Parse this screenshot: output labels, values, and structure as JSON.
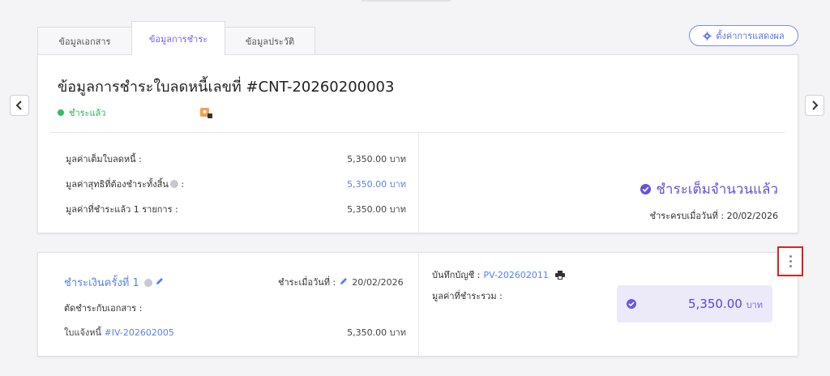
{
  "tabs": [
    {
      "label": "ข้อมูลเอกสาร"
    },
    {
      "label": "ข้อมูลการชำระ"
    },
    {
      "label": "ข้อมูลประวัติ"
    }
  ],
  "settings_button": {
    "label": "ตั้งค่าการแสดงผล"
  },
  "document": {
    "title": "ข้อมูลการชำระใบลดหนี้เลขที่ #CNT-20260200003",
    "status": "ชำระแล้ว",
    "rows": [
      {
        "label": "มูลค่าเต็มใบลดหนี้ :",
        "value": "5,350.00 บาท"
      },
      {
        "label": "มูลค่าสุทธิที่ต้องชำระทั้งสิ้น",
        "label_suffix": ":",
        "value": "5,350.00 บาท"
      },
      {
        "label": "มูลค่าที่ชำระแล้ว 1 รายการ :",
        "value": "5,350.00 บาท"
      }
    ],
    "full_paid": "ชำระเต็มจำนวนแล้ว",
    "due_label": "ชำระครบเมื่อวันที่ :",
    "due_date": "20/02/2026"
  },
  "payment": {
    "title": "ชำระเงินครั้งที่ 1",
    "paid_on_label": "ชำระเมื่อวันที่ :",
    "paid_on_date": "20/02/2026",
    "offset_label": "ตัดชำระกับเอกสาร :",
    "invoice_prefix": "ใบแจ้งหนี้",
    "invoice_id": "#IV-202602005",
    "invoice_amount": "5,350.00 บาท",
    "record_label": "บันทึกบัญชี :",
    "record_id": "PV-202602011",
    "total_label": "มูลค่าที่ชำระรวม :",
    "total_amount": "5,350.00",
    "total_unit": "บาท"
  },
  "colors": {
    "accent": "#7b5cf0",
    "link": "#5b7ff0",
    "success": "#2fbf6a",
    "highlight": "#e02020"
  }
}
